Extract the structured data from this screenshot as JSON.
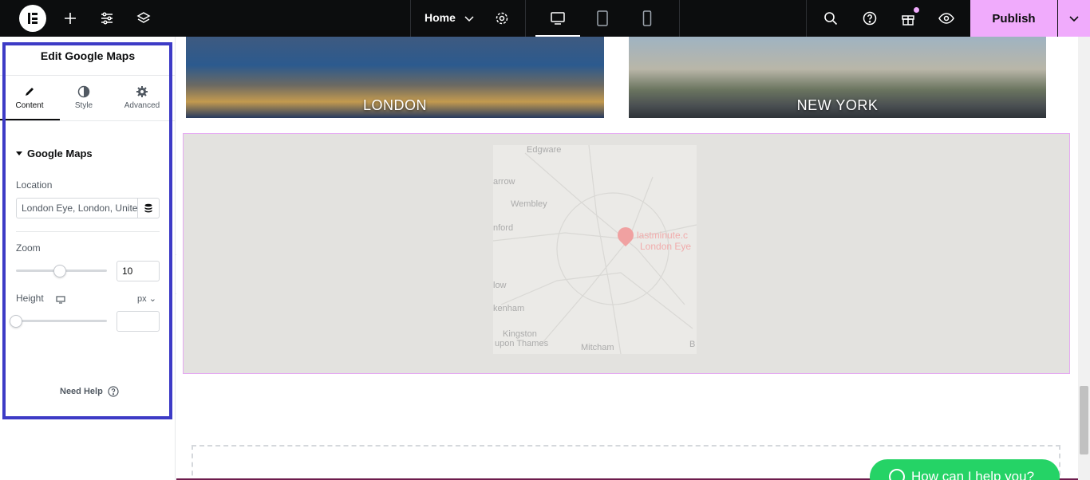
{
  "topbar": {
    "page_name": "Home",
    "publish_label": "Publish"
  },
  "panel": {
    "title": "Edit Google Maps",
    "tabs": [
      {
        "label": "Content"
      },
      {
        "label": "Style"
      },
      {
        "label": "Advanced"
      }
    ],
    "section_title": "Google Maps",
    "location_label": "Location",
    "location_value": "London Eye, London, United Kingdom",
    "zoom_label": "Zoom",
    "zoom_value": "10",
    "zoom_fraction": 0.48,
    "height_label": "Height",
    "height_unit": "px",
    "height_value": "",
    "help_label": "Need Help"
  },
  "canvas": {
    "cities": [
      {
        "name": "LONDON"
      },
      {
        "name": "NEW YORK"
      }
    ],
    "map_labels": {
      "edgware": "Edgware",
      "arrow": "arrow",
      "wembley": "Wembley",
      "nford": "nford",
      "low": "low",
      "kenham": "kenham",
      "kingston": "Kingston",
      "thames": "upon Thames",
      "mitcham": "Mitcham",
      "b": "B",
      "pin1": "lastminute.c",
      "pin2": "London Eye"
    },
    "whatsapp_label": "How can I help you?"
  }
}
